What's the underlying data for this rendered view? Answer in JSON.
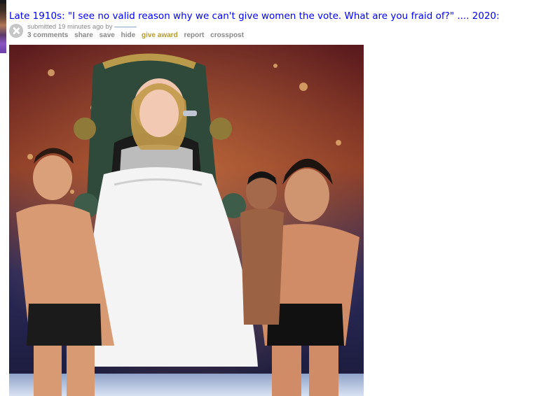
{
  "post": {
    "title": "Late 1910s: \"I see no valid reason why we can't give women the vote. What are you fraid of?\" .... 2020:",
    "tagline_prefix": "submitted 19 minutes ago by",
    "author": "––––––",
    "buttons": {
      "comments": "3 comments",
      "share": "share",
      "save": "save",
      "hide": "hide",
      "give_award": "give award",
      "report": "report",
      "crosspost": "crosspost"
    }
  },
  "colors": {
    "title_link": "#0000ff",
    "muted": "#888888",
    "award": "#b49b28"
  },
  "icons": {
    "close": "close-icon"
  }
}
